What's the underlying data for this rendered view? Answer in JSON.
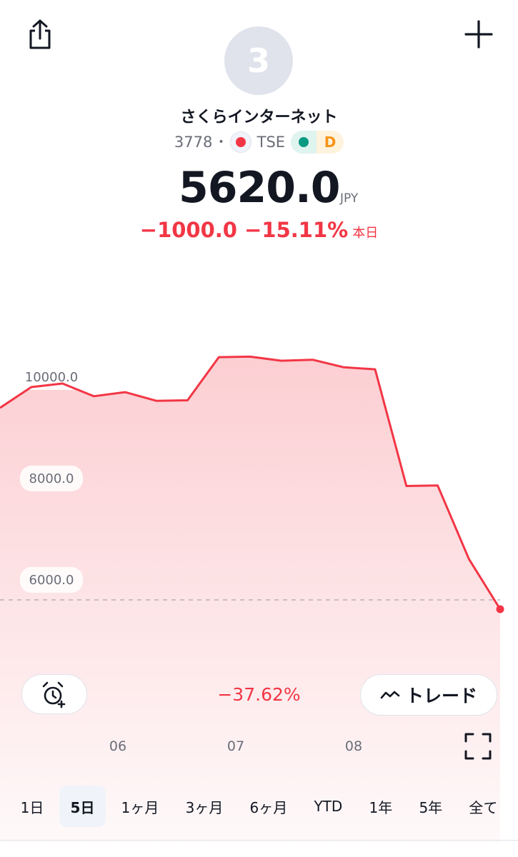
{
  "header": {
    "logo_letter": "3",
    "name": "さくらインターネット",
    "ticker": "3778",
    "separator": "•",
    "exchange": "TSE",
    "status_letter": "D"
  },
  "quote": {
    "price": "5620.0",
    "currency": "JPY",
    "change": "−1000.0",
    "change_pct": "−15.11%",
    "change_period": "本日"
  },
  "chart_data": {
    "type": "area",
    "title": "",
    "x": [
      0,
      1,
      2,
      3,
      4,
      5,
      6,
      7,
      8,
      9,
      10,
      11,
      12,
      13,
      14,
      15,
      16,
      17
    ],
    "series": [
      {
        "values": [
          9590,
          10000,
          10070,
          9820,
          9900,
          9730,
          9740,
          10590,
          10600,
          10520,
          10540,
          10390,
          10350,
          8050,
          8060,
          6610,
          5620
        ]
      }
    ],
    "y_ticks": [
      "10000.0",
      "8000.0",
      "6000.0"
    ],
    "x_ticks": [
      "06",
      "07",
      "08"
    ],
    "last_value": 5620.0,
    "line_color": "#f23645",
    "grid": false
  },
  "controls": {
    "period_change_pct": "−37.62%",
    "trade_label": "トレード"
  },
  "ranges": [
    {
      "label": "1日",
      "active": false
    },
    {
      "label": "5日",
      "active": true
    },
    {
      "label": "1ヶ月",
      "active": false
    },
    {
      "label": "3ヶ月",
      "active": false
    },
    {
      "label": "6ヶ月",
      "active": false
    },
    {
      "label": "YTD",
      "active": false
    },
    {
      "label": "1年",
      "active": false
    },
    {
      "label": "5年",
      "active": false
    },
    {
      "label": "全て",
      "active": false
    }
  ]
}
